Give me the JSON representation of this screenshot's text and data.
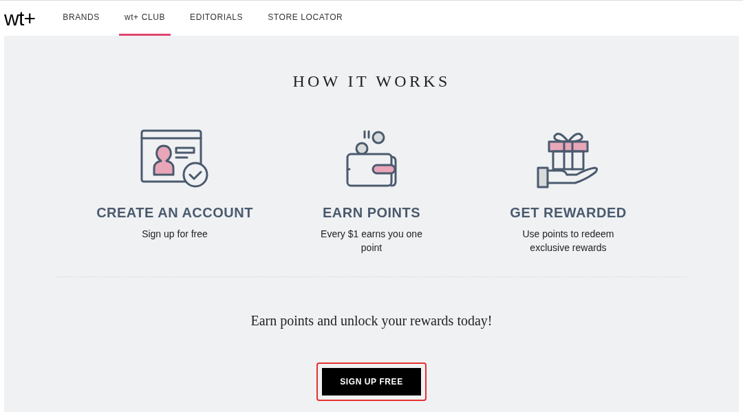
{
  "logo": "wt+",
  "nav": [
    {
      "label": "BRANDS",
      "selected": false
    },
    {
      "label": "wt+ CLUB",
      "selected": true
    },
    {
      "label": "EDITORIALS",
      "selected": false
    },
    {
      "label": "STORE LOCATOR",
      "selected": false
    }
  ],
  "section_title": "HOW IT WORKS",
  "steps": [
    {
      "kind": "account",
      "title": "CREATE AN ACCOUNT",
      "text": "Sign up for free"
    },
    {
      "kind": "wallet",
      "title": "EARN POINTS",
      "text": "Every $1 earns you one point"
    },
    {
      "kind": "gift",
      "title": "GET REWARDED",
      "text": "Use points to redeem exclusive rewards"
    }
  ],
  "tagline": "Earn points and unlock your rewards today!",
  "cta": {
    "label": "SIGN UP FREE",
    "highlighted": true
  }
}
